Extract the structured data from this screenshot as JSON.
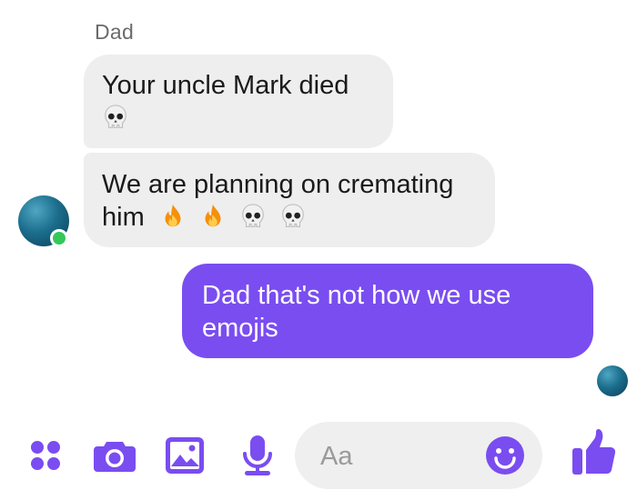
{
  "conversation": {
    "sender_name": "Dad",
    "incoming": [
      {
        "lines": [
          "Your uncle Mark died"
        ],
        "emoji": [
          "skull"
        ]
      },
      {
        "lines": [
          "We are planning on cremating",
          "him"
        ],
        "emoji": [
          "fire",
          "fire",
          "skull",
          "skull"
        ]
      }
    ],
    "outgoing": [
      {
        "lines": [
          "Dad that's not how we use",
          "emojis"
        ]
      }
    ],
    "sender_avatar_online": true
  },
  "composer": {
    "placeholder": "Aa",
    "icons": [
      "menu-dots-icon",
      "camera-icon",
      "image-icon",
      "microphone-icon",
      "emoji-icon",
      "thumbs-up-icon"
    ]
  },
  "colors": {
    "accent": "#7a4df0",
    "incoming_bubble": "#eeeeee",
    "online": "#34c759"
  }
}
